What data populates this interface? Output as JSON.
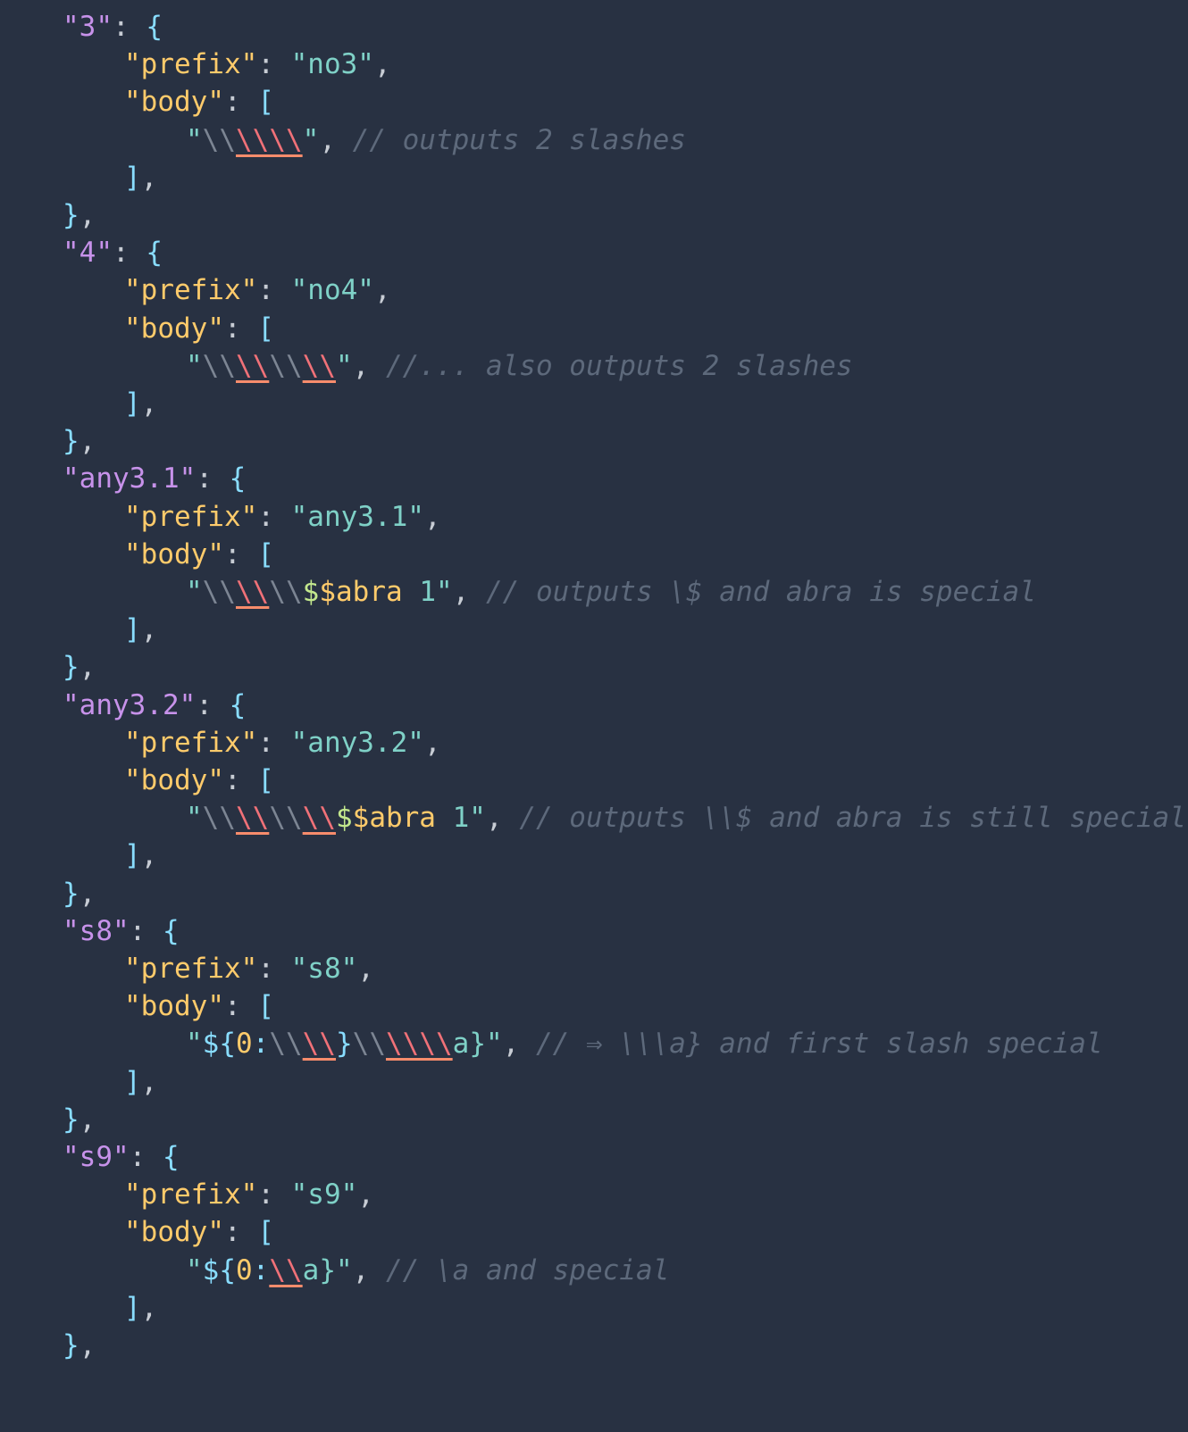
{
  "editor": {
    "lines": [
      {
        "indent": 1,
        "tokens": [
          {
            "t": "\"3\"",
            "c": "key-lv1"
          },
          {
            "t": ": ",
            "c": "plain"
          },
          {
            "t": "{",
            "c": "brace"
          }
        ]
      },
      {
        "indent": 2,
        "tokens": [
          {
            "t": "\"prefix\"",
            "c": "prop"
          },
          {
            "t": ": ",
            "c": "plain"
          },
          {
            "t": "\"no3\"",
            "c": "str"
          },
          {
            "t": ",",
            "c": "plain"
          }
        ]
      },
      {
        "indent": 2,
        "tokens": [
          {
            "t": "\"body\"",
            "c": "prop"
          },
          {
            "t": ": ",
            "c": "plain"
          },
          {
            "t": "[",
            "c": "bracket"
          }
        ]
      },
      {
        "indent": 3,
        "tokens": [
          {
            "t": "\"",
            "c": "str"
          },
          {
            "t": "\\\\",
            "c": "esc"
          },
          {
            "t": "\\\\\\\\",
            "c": "esc-hi"
          },
          {
            "t": "\"",
            "c": "str"
          },
          {
            "t": ", ",
            "c": "plain"
          },
          {
            "t": "// outputs 2 slashes",
            "c": "comment"
          }
        ]
      },
      {
        "indent": 2,
        "tokens": [
          {
            "t": "]",
            "c": "bracket"
          },
          {
            "t": ",",
            "c": "plain"
          }
        ]
      },
      {
        "indent": 1,
        "tokens": [
          {
            "t": "}",
            "c": "brace"
          },
          {
            "t": ",",
            "c": "plain"
          }
        ]
      },
      {
        "indent": 1,
        "tokens": [
          {
            "t": "\"4\"",
            "c": "key-lv1"
          },
          {
            "t": ": ",
            "c": "plain"
          },
          {
            "t": "{",
            "c": "brace"
          }
        ]
      },
      {
        "indent": 2,
        "tokens": [
          {
            "t": "\"prefix\"",
            "c": "prop"
          },
          {
            "t": ": ",
            "c": "plain"
          },
          {
            "t": "\"no4\"",
            "c": "str"
          },
          {
            "t": ",",
            "c": "plain"
          }
        ]
      },
      {
        "indent": 2,
        "tokens": [
          {
            "t": "\"body\"",
            "c": "prop"
          },
          {
            "t": ": ",
            "c": "plain"
          },
          {
            "t": "[",
            "c": "bracket"
          }
        ]
      },
      {
        "indent": 3,
        "tokens": [
          {
            "t": "\"",
            "c": "str"
          },
          {
            "t": "\\\\",
            "c": "esc"
          },
          {
            "t": "\\\\",
            "c": "esc-hi"
          },
          {
            "t": "\\\\",
            "c": "esc"
          },
          {
            "t": "\\\\",
            "c": "esc-hi"
          },
          {
            "t": "\"",
            "c": "str"
          },
          {
            "t": ", ",
            "c": "plain"
          },
          {
            "t": "//... also outputs 2 slashes",
            "c": "comment"
          }
        ]
      },
      {
        "indent": 2,
        "tokens": [
          {
            "t": "]",
            "c": "bracket"
          },
          {
            "t": ",",
            "c": "plain"
          }
        ]
      },
      {
        "indent": 1,
        "tokens": [
          {
            "t": "}",
            "c": "brace"
          },
          {
            "t": ",",
            "c": "plain"
          }
        ]
      },
      {
        "indent": 1,
        "tokens": [
          {
            "t": "\"any3.1\"",
            "c": "key-lv1"
          },
          {
            "t": ": ",
            "c": "plain"
          },
          {
            "t": "{",
            "c": "brace"
          }
        ]
      },
      {
        "indent": 2,
        "tokens": [
          {
            "t": "\"prefix\"",
            "c": "prop"
          },
          {
            "t": ": ",
            "c": "plain"
          },
          {
            "t": "\"any3.1\"",
            "c": "str"
          },
          {
            "t": ",",
            "c": "plain"
          }
        ]
      },
      {
        "indent": 2,
        "tokens": [
          {
            "t": "\"body\"",
            "c": "prop"
          },
          {
            "t": ": ",
            "c": "plain"
          },
          {
            "t": "[",
            "c": "bracket"
          }
        ]
      },
      {
        "indent": 3,
        "tokens": [
          {
            "t": "\"",
            "c": "str"
          },
          {
            "t": "\\\\",
            "c": "esc"
          },
          {
            "t": "\\\\",
            "c": "esc-hi"
          },
          {
            "t": "\\\\",
            "c": "esc"
          },
          {
            "t": "$",
            "c": "dollar"
          },
          {
            "t": "$abra",
            "c": "abra"
          },
          {
            "t": " 1\"",
            "c": "str"
          },
          {
            "t": ", ",
            "c": "plain"
          },
          {
            "t": "// outputs \\$ and abra is special",
            "c": "comment"
          }
        ]
      },
      {
        "indent": 2,
        "tokens": [
          {
            "t": "]",
            "c": "bracket"
          },
          {
            "t": ",",
            "c": "plain"
          }
        ]
      },
      {
        "indent": 1,
        "tokens": [
          {
            "t": "}",
            "c": "brace"
          },
          {
            "t": ",",
            "c": "plain"
          }
        ]
      },
      {
        "indent": 1,
        "tokens": [
          {
            "t": "\"any3.2\"",
            "c": "key-lv1"
          },
          {
            "t": ": ",
            "c": "plain"
          },
          {
            "t": "{",
            "c": "brace"
          }
        ]
      },
      {
        "indent": 2,
        "tokens": [
          {
            "t": "\"prefix\"",
            "c": "prop"
          },
          {
            "t": ": ",
            "c": "plain"
          },
          {
            "t": "\"any3.2\"",
            "c": "str"
          },
          {
            "t": ",",
            "c": "plain"
          }
        ]
      },
      {
        "indent": 2,
        "tokens": [
          {
            "t": "\"body\"",
            "c": "prop"
          },
          {
            "t": ": ",
            "c": "plain"
          },
          {
            "t": "[",
            "c": "bracket"
          }
        ]
      },
      {
        "indent": 3,
        "tokens": [
          {
            "t": "\"",
            "c": "str"
          },
          {
            "t": "\\\\",
            "c": "esc"
          },
          {
            "t": "\\\\",
            "c": "esc-hi"
          },
          {
            "t": "\\\\",
            "c": "esc"
          },
          {
            "t": "\\\\",
            "c": "esc-hi"
          },
          {
            "t": "$",
            "c": "dollar"
          },
          {
            "t": "$abra",
            "c": "abra"
          },
          {
            "t": " 1\"",
            "c": "str"
          },
          {
            "t": ", ",
            "c": "plain"
          },
          {
            "t": "// outputs \\\\$ and abra is still special",
            "c": "comment"
          }
        ]
      },
      {
        "indent": 2,
        "tokens": [
          {
            "t": "]",
            "c": "bracket"
          },
          {
            "t": ",",
            "c": "plain"
          }
        ]
      },
      {
        "indent": 1,
        "tokens": [
          {
            "t": "}",
            "c": "brace"
          },
          {
            "t": ",",
            "c": "plain"
          }
        ]
      },
      {
        "indent": 1,
        "tokens": [
          {
            "t": "\"s8\"",
            "c": "key-lv1"
          },
          {
            "t": ": ",
            "c": "plain"
          },
          {
            "t": "{",
            "c": "brace"
          }
        ]
      },
      {
        "indent": 2,
        "tokens": [
          {
            "t": "\"prefix\"",
            "c": "prop"
          },
          {
            "t": ": ",
            "c": "plain"
          },
          {
            "t": "\"s8\"",
            "c": "str"
          },
          {
            "t": ",",
            "c": "plain"
          }
        ]
      },
      {
        "indent": 2,
        "tokens": [
          {
            "t": "\"body\"",
            "c": "prop"
          },
          {
            "t": ": ",
            "c": "plain"
          },
          {
            "t": "[",
            "c": "bracket"
          }
        ]
      },
      {
        "indent": 3,
        "tokens": [
          {
            "t": "\"",
            "c": "str"
          },
          {
            "t": "${",
            "c": "var"
          },
          {
            "t": "0",
            "c": "var-num"
          },
          {
            "t": ":",
            "c": "var"
          },
          {
            "t": "\\\\",
            "c": "esc"
          },
          {
            "t": "\\\\",
            "c": "esc-hi"
          },
          {
            "t": "}",
            "c": "var"
          },
          {
            "t": "\\\\",
            "c": "esc"
          },
          {
            "t": "\\\\\\\\",
            "c": "esc-hi"
          },
          {
            "t": "a}\"",
            "c": "str"
          },
          {
            "t": ", ",
            "c": "plain"
          },
          {
            "t": "// ⇒ \\\\\\a} and first slash special",
            "c": "comment"
          }
        ]
      },
      {
        "indent": 2,
        "tokens": [
          {
            "t": "]",
            "c": "bracket"
          },
          {
            "t": ",",
            "c": "plain"
          }
        ]
      },
      {
        "indent": 1,
        "tokens": [
          {
            "t": "}",
            "c": "brace"
          },
          {
            "t": ",",
            "c": "plain"
          }
        ]
      },
      {
        "indent": 1,
        "tokens": [
          {
            "t": "\"s9\"",
            "c": "key-lv1"
          },
          {
            "t": ": ",
            "c": "plain"
          },
          {
            "t": "{",
            "c": "brace"
          }
        ]
      },
      {
        "indent": 2,
        "tokens": [
          {
            "t": "\"prefix\"",
            "c": "prop"
          },
          {
            "t": ": ",
            "c": "plain"
          },
          {
            "t": "\"s9\"",
            "c": "str"
          },
          {
            "t": ",",
            "c": "plain"
          }
        ]
      },
      {
        "indent": 2,
        "tokens": [
          {
            "t": "\"body\"",
            "c": "prop"
          },
          {
            "t": ": ",
            "c": "plain"
          },
          {
            "t": "[",
            "c": "bracket"
          }
        ]
      },
      {
        "indent": 3,
        "tokens": [
          {
            "t": "\"",
            "c": "str"
          },
          {
            "t": "${",
            "c": "var"
          },
          {
            "t": "0",
            "c": "var-num"
          },
          {
            "t": ":",
            "c": "var"
          },
          {
            "t": "\\\\",
            "c": "esc-hi"
          },
          {
            "t": "a}\"",
            "c": "str"
          },
          {
            "t": ", ",
            "c": "plain"
          },
          {
            "t": "// \\a and special",
            "c": "comment"
          }
        ]
      },
      {
        "indent": 2,
        "tokens": [
          {
            "t": "]",
            "c": "bracket"
          },
          {
            "t": ",",
            "c": "plain"
          }
        ]
      },
      {
        "indent": 1,
        "tokens": [
          {
            "t": "}",
            "c": "brace"
          },
          {
            "t": ",",
            "c": "plain"
          }
        ]
      }
    ]
  }
}
